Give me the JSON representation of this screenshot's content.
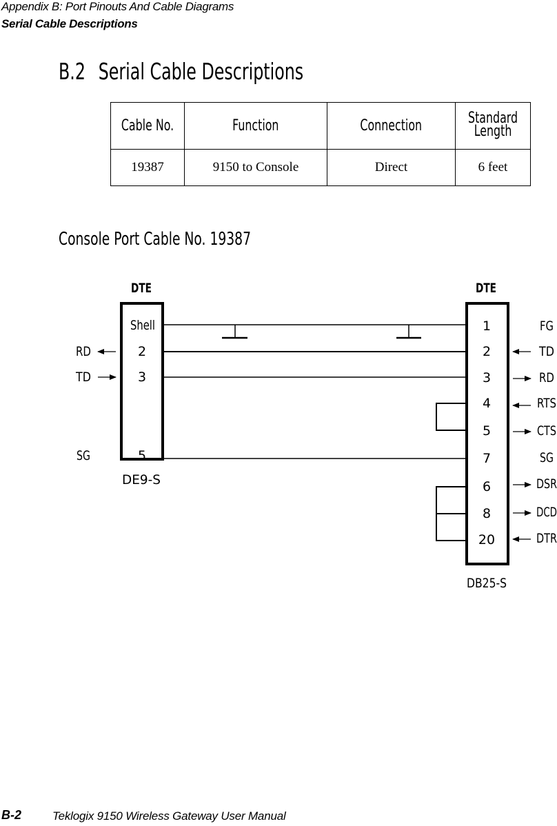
{
  "header": {
    "chapter": "Appendix B: Port Pinouts And Cable Diagrams",
    "section": "Serial Cable Descriptions"
  },
  "section": {
    "number": "B.2",
    "title": "Serial Cable Descriptions"
  },
  "cable_table": {
    "headers": [
      "Cable No.",
      "Function",
      "Connection",
      "Standard Length"
    ],
    "header_standard_length_lines": [
      "Standard",
      "Length"
    ],
    "rows": [
      [
        "19387",
        "9150 to Console",
        "Direct",
        "6 feet"
      ]
    ]
  },
  "diagram": {
    "title": "Console Port Cable No. 19387",
    "left_connector": {
      "role": "DTE",
      "type": "DE9-S",
      "pins": [
        {
          "pin": "Shell",
          "signal": "",
          "direction": ""
        },
        {
          "pin": "2",
          "signal": "RD",
          "direction": "out"
        },
        {
          "pin": "3",
          "signal": "TD",
          "direction": "in"
        },
        {
          "pin": "5",
          "signal": "SG",
          "direction": ""
        }
      ]
    },
    "right_connector": {
      "role": "DTE",
      "type": "DB25-S",
      "pins": [
        {
          "pin": "1",
          "signal": "FG",
          "direction": ""
        },
        {
          "pin": "2",
          "signal": "TD",
          "direction": "in"
        },
        {
          "pin": "3",
          "signal": "RD",
          "direction": "out"
        },
        {
          "pin": "4",
          "signal": "RTS",
          "direction": "in"
        },
        {
          "pin": "5",
          "signal": "CTS",
          "direction": "out"
        },
        {
          "pin": "7",
          "signal": "SG",
          "direction": ""
        },
        {
          "pin": "6",
          "signal": "DSR",
          "direction": "out"
        },
        {
          "pin": "8",
          "signal": "DCD",
          "direction": "out"
        },
        {
          "pin": "20",
          "signal": "DTR",
          "direction": "in"
        }
      ]
    },
    "connections": [
      {
        "from": "Shell",
        "to": "1",
        "note": "shield grounded both ends"
      },
      {
        "from": "2",
        "to": "2"
      },
      {
        "from": "3",
        "to": "3"
      },
      {
        "from": "5",
        "to": "7"
      }
    ],
    "loopbacks": [
      [
        "4",
        "5"
      ],
      [
        "6",
        "8",
        "20"
      ]
    ]
  },
  "footer": {
    "page": "B-2",
    "manual_title": "Teklogix 9150 Wireless Gateway User Manual"
  }
}
